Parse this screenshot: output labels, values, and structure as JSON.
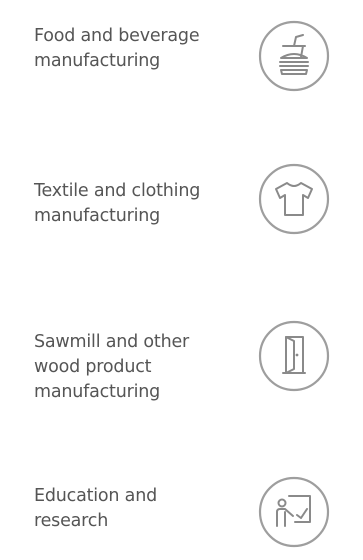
{
  "industries": [
    {
      "label_line1": "Food and beverage",
      "label_line2": "manufacturing",
      "label_line3": "",
      "icon": "food-drink-icon"
    },
    {
      "label_line1": "Textile and clothing",
      "label_line2": "manufacturing",
      "label_line3": "",
      "icon": "tshirt-icon"
    },
    {
      "label_line1": "Sawmill and other",
      "label_line2": "wood product",
      "label_line3": "manufacturing",
      "icon": "door-icon"
    },
    {
      "label_line1": "Education and",
      "label_line2": "research",
      "label_line3": "",
      "icon": "teacher-board-icon"
    }
  ],
  "colors": {
    "text": "#555555",
    "icon_stroke": "#9e9e9e"
  }
}
